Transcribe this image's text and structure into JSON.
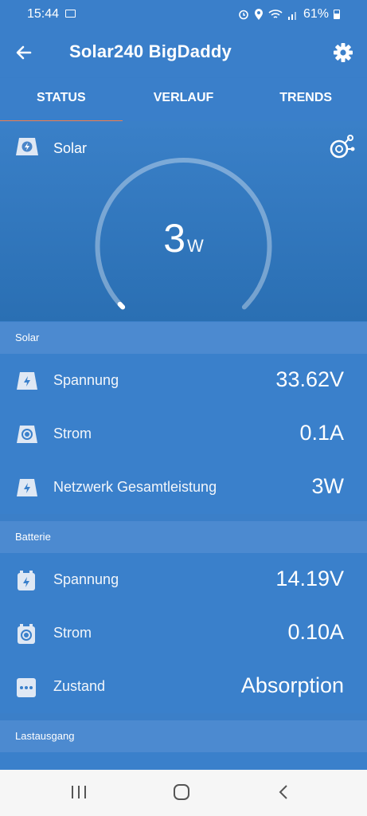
{
  "status_bar": {
    "time": "15:44",
    "battery": "61%"
  },
  "app_bar": {
    "title": "Solar240 BigDaddy",
    "back_icon": "arrow-left-icon",
    "settings_icon": "gear-icon"
  },
  "tabs": [
    {
      "label": "STATUS",
      "active": true
    },
    {
      "label": "VERLAUF",
      "active": false
    },
    {
      "label": "TRENDS",
      "active": false
    }
  ],
  "gauge": {
    "label": "Solar",
    "value": "3",
    "unit": "W",
    "fraction": 0.01
  },
  "sections": {
    "solar": {
      "title": "Solar",
      "rows": [
        {
          "label": "Spannung",
          "value": "33.62V",
          "icon": "solar-bolt-icon"
        },
        {
          "label": "Strom",
          "value": "0.1A",
          "icon": "current-icon"
        },
        {
          "label": "Netzwerk Gesamtleistung",
          "value": "3W",
          "icon": "solar-bolt-icon"
        }
      ]
    },
    "battery": {
      "title": "Batterie",
      "rows": [
        {
          "label": "Spannung",
          "value": "14.19V",
          "icon": "battery-bolt-icon"
        },
        {
          "label": "Strom",
          "value": "0.10A",
          "icon": "battery-current-icon"
        },
        {
          "label": "Zustand",
          "value": "Absorption",
          "icon": "state-dots-icon"
        }
      ]
    },
    "load": {
      "title": "Lastausgang"
    }
  },
  "colors": {
    "primary": "#3a7fca",
    "accent": "#ef7d4c",
    "section_header": "#4c8ad0"
  }
}
